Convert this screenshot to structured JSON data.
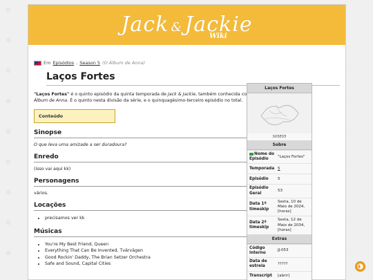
{
  "header": {
    "logo_main": "Jack",
    "logo_amp": "&",
    "logo_second": "Jackie",
    "logo_sub": "Wiki"
  },
  "breadcrumb": {
    "prefix": "Em",
    "link1": "Episódios",
    "link2": "Season 5",
    "note": "(O Álbum de Anna)"
  },
  "page": {
    "title": "Laços Fortes",
    "intro_bold": "\"Laços Fortes\"",
    "intro_text1": " é o quinto episódio da quinta temporada de ",
    "intro_show": "Jack & Jackie",
    "intro_text2": ", também conhecida como ",
    "intro_alt": "O Álbum de Anna",
    "intro_text3": ". É o quinto nesta divisão da série, e o quinquagésimo-terceiro episódio no total.",
    "toc_label": "Conteúdo"
  },
  "sections": {
    "sinopse_title": "Sinopse",
    "sinopse_text": "O que leva uma amizade a ser duradoura?",
    "enredo_title": "Enredo",
    "enredo_text": "(isso vai aqui kk)",
    "personagens_title": "Personagens",
    "personagens_text": "vários.",
    "locacoes_title": "Locações",
    "locacoes_items": [
      "precisamos ver kk"
    ],
    "musicas_title": "Músicas",
    "musicas_items": [
      "You're My Best Friend, Queen",
      "Everything That Can Be Invented, Tvärvägen",
      "Good Rockin' Daddy, The Brian Setzer Orchestra",
      "Safe and Sound, Capital Cities"
    ]
  },
  "infobox": {
    "title": "Laços Fortes",
    "caption": "S05E05",
    "section_about": "Sobre",
    "rows": [
      {
        "k": "Nome do Episódio",
        "v": "\"Laços Fortes\""
      },
      {
        "k": "Temporada",
        "v": "5"
      },
      {
        "k": "Episódio",
        "v": "5"
      },
      {
        "k": "Episódio Geral",
        "v": "53"
      },
      {
        "k": "Data 1º timeskip",
        "v": "Sexta, 10 de Maio de 2024, [horas]"
      },
      {
        "k": "Data 2º timeskip",
        "v": "Sexta, 12 de Maio de 2034, [horas]"
      }
    ],
    "section_extras": "Extras",
    "extras": [
      {
        "k": "Código interno",
        "v": "JJ-053"
      },
      {
        "k": "Data de estreia",
        "v": "?????"
      },
      {
        "k": "Transcript",
        "v": "[abrir]"
      }
    ]
  },
  "colors": {
    "banner": "#f4bb3a",
    "toc_bg": "#fdf1bf",
    "theme_button": "#f0a020"
  }
}
